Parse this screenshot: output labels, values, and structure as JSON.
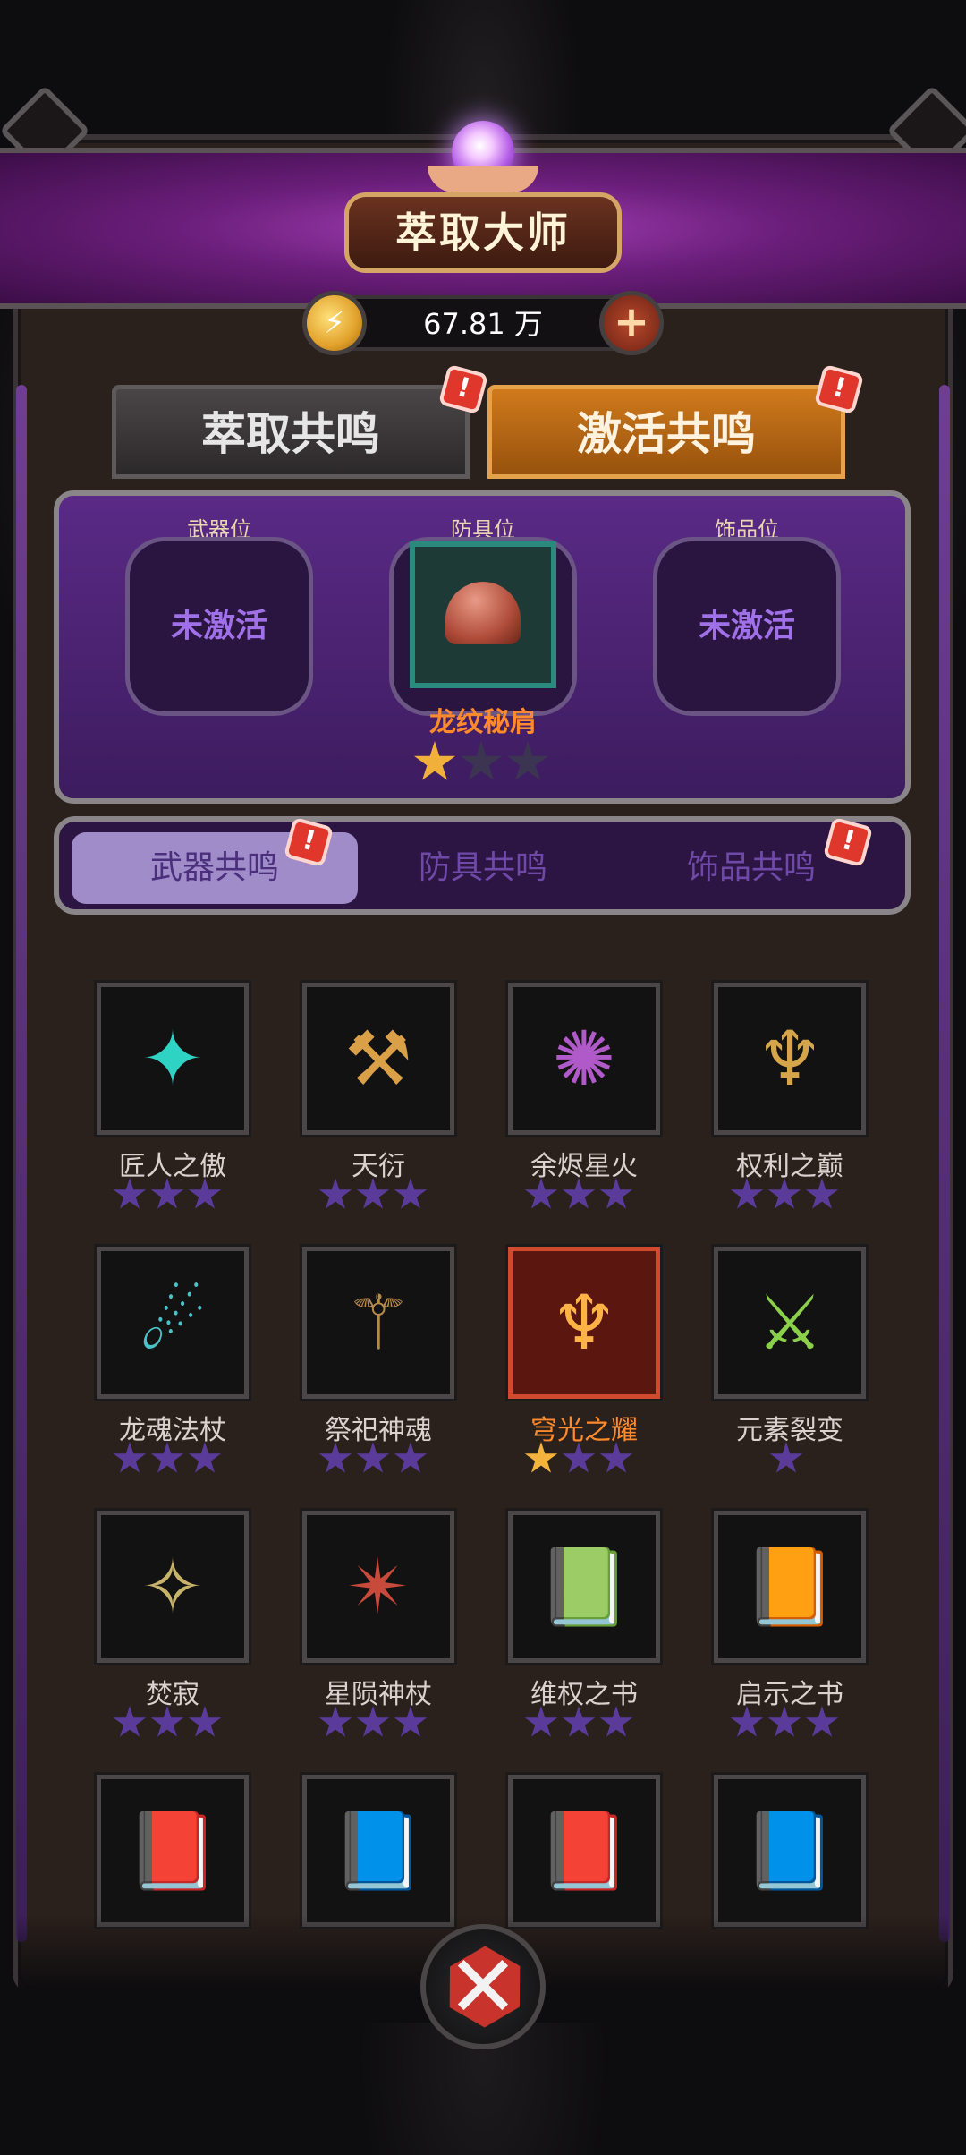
{
  "header": {
    "title": "萃取大师",
    "currency_amount": "67.81 万",
    "currency_icon": "coin-icon",
    "add_icon": "plus-icon"
  },
  "tabs": [
    {
      "label": "萃取共鸣",
      "badge": "!"
    },
    {
      "label": "激活共鸣",
      "badge": "!",
      "active": true
    }
  ],
  "equipment": {
    "slots": [
      {
        "label": "武器位",
        "value": "未激活"
      },
      {
        "label": "防具位",
        "item": "龙纹秘肩",
        "stars": 1,
        "max_stars": 3
      },
      {
        "label": "饰品位",
        "value": "未激活"
      }
    ]
  },
  "subtabs": [
    {
      "label": "武器共鸣",
      "badge": "!",
      "active": true
    },
    {
      "label": "防具共鸣"
    },
    {
      "label": "饰品共鸣",
      "badge": "!"
    }
  ],
  "items": [
    {
      "name": "匠人之傲",
      "stars": 0,
      "max": 3
    },
    {
      "name": "天衍",
      "stars": 0,
      "max": 3
    },
    {
      "name": "余烬星火",
      "stars": 0,
      "max": 3
    },
    {
      "name": "权利之巅",
      "stars": 0,
      "max": 3
    },
    {
      "name": "龙魂法杖",
      "stars": 0,
      "max": 3
    },
    {
      "name": "祭祀神魂",
      "stars": 0,
      "max": 3
    },
    {
      "name": "穹光之耀",
      "stars": 1,
      "max": 3,
      "selected": true
    },
    {
      "name": "元素裂变",
      "stars": 0,
      "max": 1
    },
    {
      "name": "焚寂",
      "stars": 0,
      "max": 3
    },
    {
      "name": "星陨神杖",
      "stars": 0,
      "max": 3
    },
    {
      "name": "维权之书",
      "stars": 0,
      "max": 3
    },
    {
      "name": "启示之书",
      "stars": 0,
      "max": 3
    },
    {
      "name": "",
      "stars": 0,
      "max": 0
    },
    {
      "name": "",
      "stars": 0,
      "max": 0
    },
    {
      "name": "",
      "stars": 0,
      "max": 0
    },
    {
      "name": "",
      "stars": 0,
      "max": 0
    }
  ],
  "colors": {
    "accent_orange": "#ff8a2b",
    "purple": "#5a2a86",
    "star_on": "#f3b33d"
  }
}
